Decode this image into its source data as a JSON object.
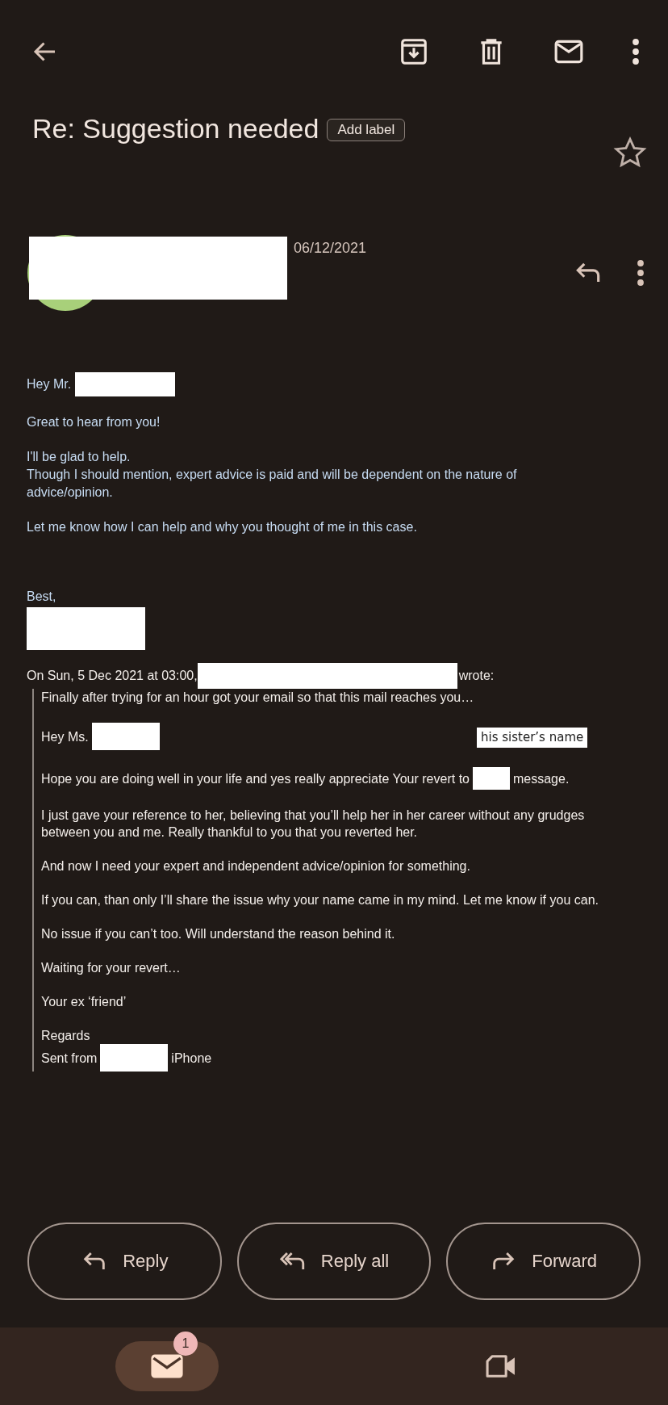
{
  "subject": {
    "title": "Re: Suggestion needed",
    "label_chip": "Add label",
    "starred": false
  },
  "sender": {
    "date": "06/12/2021"
  },
  "reply": {
    "paragraphs": [
      {
        "lines": [
          [
            {
              "kind": "text",
              "text": "Hey Mr."
            },
            {
              "kind": "redacted"
            }
          ]
        ]
      },
      {
        "lines": [
          [
            {
              "kind": "text",
              "text": "Great to hear from you!"
            }
          ]
        ]
      },
      {
        "lines": [
          [
            {
              "kind": "text",
              "text": "I'll be glad to help."
            }
          ],
          [
            {
              "kind": "text",
              "text": "Though I should mention, expert advice is paid and will be dependent on the nature of advice/opinion."
            }
          ]
        ]
      },
      {
        "lines": [
          [
            {
              "kind": "text",
              "text": "Let me know how I can help and why you thought of me in this case."
            }
          ]
        ]
      },
      {
        "lines": [
          [
            {
              "kind": "text",
              "text": "Best,"
            }
          ],
          [
            {
              "kind": "redacted"
            }
          ]
        ]
      }
    ]
  },
  "attribution": {
    "before": "On Sun, 5 Dec 2021 at 03:00,",
    "after": "wrote:"
  },
  "quote": {
    "note": "his sister’s name",
    "paragraphs": [
      {
        "lines": [
          [
            {
              "kind": "text",
              "text": "Finally after trying for an hour got your email so that this mail reaches you…"
            }
          ]
        ]
      },
      {
        "lines": [
          [
            {
              "kind": "text",
              "text": "Hey Ms."
            },
            {
              "kind": "redacted"
            }
          ]
        ]
      },
      {
        "lines": [
          [
            {
              "kind": "text",
              "text": "Hope you are doing well in your life and yes really appreciate Your revert to"
            },
            {
              "kind": "redacted"
            },
            {
              "kind": "text",
              "text": "message."
            }
          ]
        ]
      },
      {
        "lines": [
          [
            {
              "kind": "text",
              "text": "I just gave your reference to her, believing that you’ll help her in her career without any grudges between you and me. Really thankful to you that you reverted  her."
            }
          ]
        ]
      },
      {
        "lines": [
          [
            {
              "kind": "text",
              "text": "And now I need your expert and independent advice/opinion for something."
            }
          ]
        ]
      },
      {
        "lines": [
          [
            {
              "kind": "text",
              "text": "If you can, than only I’ll share the issue why your name came in my mind. Let me know if you can."
            }
          ]
        ]
      },
      {
        "lines": [
          [
            {
              "kind": "text",
              "text": "No issue if you can’t too. Will understand the reason behind it."
            }
          ]
        ]
      },
      {
        "lines": [
          [
            {
              "kind": "text",
              "text": "Waiting for your revert…"
            }
          ]
        ]
      },
      {
        "lines": [
          [
            {
              "kind": "text",
              "text": "Your ex ‘friend’"
            }
          ]
        ]
      },
      {
        "lines": [
          [
            {
              "kind": "text",
              "text": "Regards"
            }
          ],
          [
            {
              "kind": "text",
              "text": "Sent from"
            },
            {
              "kind": "redacted"
            },
            {
              "kind": "text",
              "text": "iPhone"
            }
          ]
        ]
      }
    ]
  },
  "actions": [
    {
      "kind": "reply",
      "label": "Reply"
    },
    {
      "kind": "reply_all",
      "label": "Reply all"
    },
    {
      "kind": "forward",
      "label": "Forward"
    }
  ],
  "bottom_nav": [
    {
      "kind": "mail",
      "selected": true,
      "badge": "1"
    },
    {
      "kind": "meet",
      "selected": false
    }
  ]
}
